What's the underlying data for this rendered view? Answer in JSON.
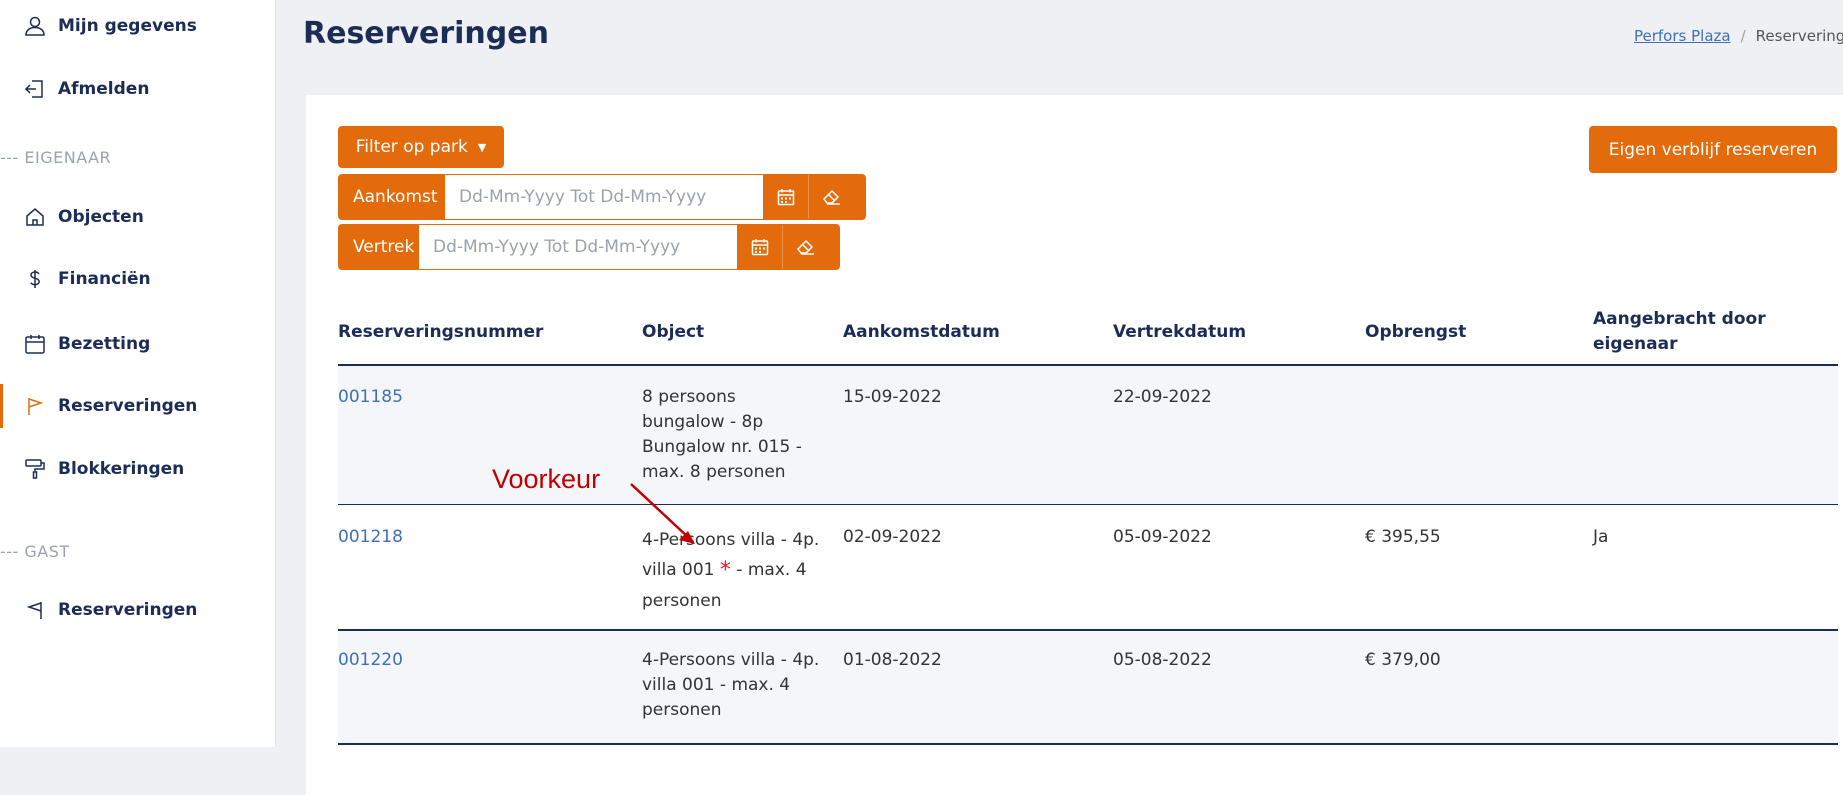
{
  "sidebar": {
    "top_items": [
      {
        "label": "Mijn gegevens",
        "icon": "user-icon"
      },
      {
        "label": "Afmelden",
        "icon": "logout-icon"
      }
    ],
    "owner_section": "--- EIGENAAR",
    "owner_items": [
      {
        "label": "Objecten",
        "icon": "home-icon"
      },
      {
        "label": "Financiën",
        "icon": "dollar-icon"
      },
      {
        "label": "Bezetting",
        "icon": "calendar-icon"
      },
      {
        "label": "Reserveringen",
        "icon": "flag-icon",
        "active": true
      },
      {
        "label": "Blokkeringen",
        "icon": "paint-roller-icon"
      }
    ],
    "guest_section": "--- GAST",
    "guest_items": [
      {
        "label": "Reserveringen",
        "icon": "flag-icon"
      }
    ]
  },
  "header": {
    "title": "Reserveringen",
    "breadcrumb": {
      "link": "Perfors Plaza",
      "current": "Reservering"
    }
  },
  "toolbar": {
    "filter_label": "Filter op park",
    "reserve_label": "Eigen verblijf reserveren",
    "arrival_label": "Aankomst",
    "departure_label": "Vertrek",
    "date_placeholder": "Dd-Mm-Yyyy Tot Dd-Mm-Yyyy"
  },
  "table": {
    "columns": [
      "Reserveringsnummer",
      "Object",
      "Aankomstdatum",
      "Vertrekdatum",
      "Opbrengst",
      "Aangebracht door eigenaar"
    ],
    "rows": [
      {
        "number": "001185",
        "object": [
          "8 persoons",
          "bungalow - 8p",
          "Bungalow nr. 015 -",
          "max. 8 personen"
        ],
        "arrival": "15-09-2022",
        "departure": "22-09-2022",
        "revenue": "",
        "by_owner": ""
      },
      {
        "number": "001218",
        "object": [
          "4-Persoons villa - 4p.",
          "villa 001",
          "- max. 4",
          "personen"
        ],
        "arrival": "02-09-2022",
        "departure": "05-09-2022",
        "revenue": "€ 395,55",
        "by_owner": "Ja"
      },
      {
        "number": "001220",
        "object": [
          "4-Persoons villa - 4p.",
          "villa 001 - max. 4",
          "personen"
        ],
        "arrival": "01-08-2022",
        "departure": "05-08-2022",
        "revenue": "€ 379,00",
        "by_owner": ""
      }
    ],
    "preference_marker": "*"
  },
  "annotation": "Voorkeur",
  "colors": {
    "accent": "#e36b0c",
    "navy": "#1b2d57",
    "link": "#3f6fb8",
    "annotation": "#c00000"
  }
}
